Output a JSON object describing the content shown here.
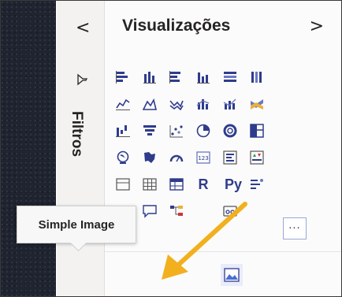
{
  "filters_panel": {
    "collapse_glyph": "<",
    "label": "Filtros",
    "icon": "funnel-icon"
  },
  "visualizations_panel": {
    "title": "Visualizações",
    "expand_glyph": ">",
    "r_visual_label": "R",
    "python_visual_label": "Py",
    "more_label": "···",
    "icons": [
      "stacked-bar-icon",
      "stacked-column-icon",
      "clustered-bar-icon",
      "clustered-column-icon",
      "100pct-bar-icon",
      "100pct-column-icon",
      "line-chart-icon",
      "area-chart-icon",
      "stacked-area-icon",
      "line-clustered-column-icon",
      "line-stacked-column-icon",
      "ribbon-chart-icon",
      "waterfall-icon",
      "funnel-chart-icon",
      "scatter-icon",
      "pie-icon",
      "donut-icon",
      "treemap-icon",
      "map-icon",
      "filled-map-icon",
      "gauge-icon",
      "card-icon",
      "multirow-card-icon",
      "kpi-icon",
      "slicer-icon",
      "table-icon",
      "matrix-icon",
      "r-visual-icon",
      "python-visual-icon",
      "key-influencers-icon",
      "smart-narrative-icon",
      "qa-icon",
      "decomposition-tree-icon",
      "paginated-report-icon",
      "more-visuals-icon",
      "simple-image-icon"
    ]
  },
  "tooltip": {
    "text": "Simple Image"
  },
  "colors": {
    "accent": "#2f3c8c",
    "arrow": "#f2b01e",
    "dark_strip": "#1f2430"
  }
}
